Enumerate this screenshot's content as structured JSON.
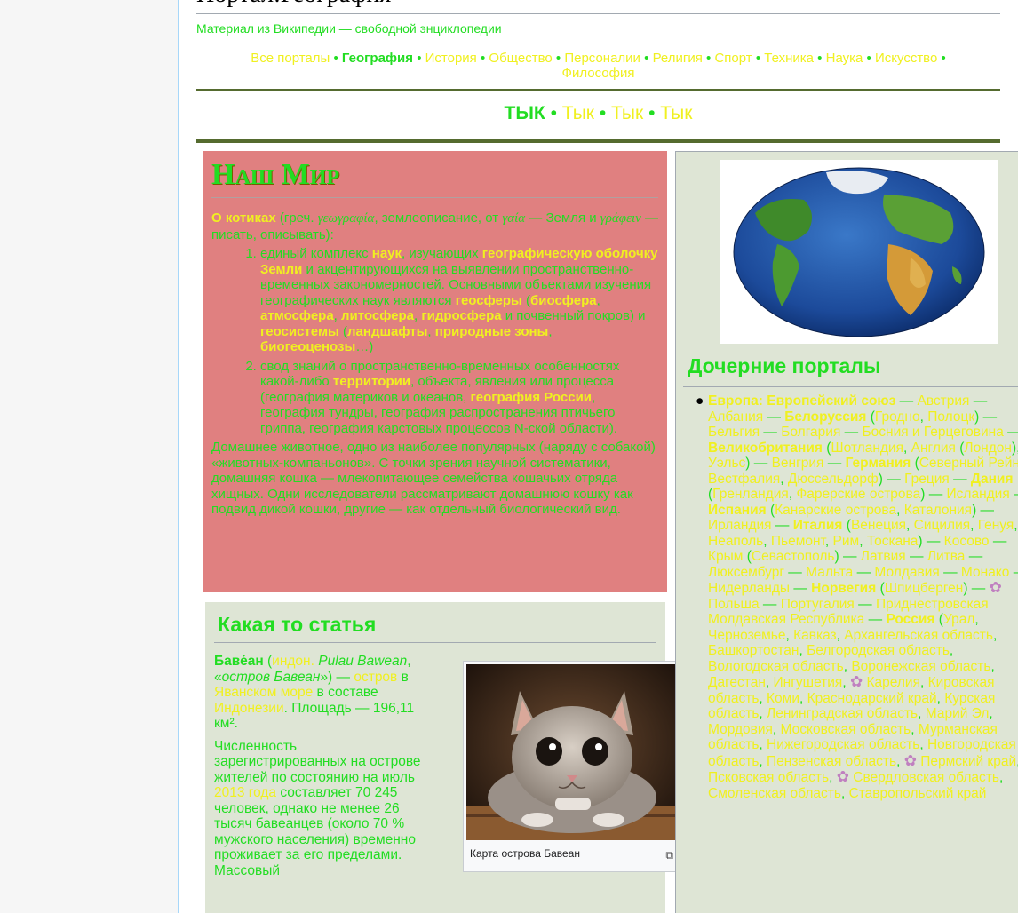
{
  "page": {
    "title": "Портал:География",
    "subtitle": "Материал из Википедии — свободной энциклопедии"
  },
  "portal_nav": {
    "items": [
      "Все порталы",
      "География",
      "История",
      "Общество",
      "Персоналии",
      "Религия",
      "Спорт",
      "Техника",
      "Наука",
      "Искусство",
      "Философия"
    ],
    "separator": "•"
  },
  "tyk_nav": {
    "items": [
      "ТЫК",
      "Тык",
      "Тык",
      "Тык"
    ],
    "separator": "•"
  },
  "world": {
    "title": "Наш Мир",
    "intro": {
      "bold": "О котиках",
      "text1": " (греч. ",
      "greek1": "γεωγραφία",
      "text2": ", землеописание, от ",
      "greek2": "γαία",
      "text3": " — Земля и ",
      "greek3": "γράφειν",
      "text4": " — писать, описывать):"
    },
    "item1": {
      "t1": "единый комплекс ",
      "l1": "наук",
      "t2": ", изучающих ",
      "l2": "географическую оболочку Земли",
      "t3": " и акцентирующихся на выявлении пространственно-временных закономерностей. Основными объектами изучения географических наук являются ",
      "l3": "геосферы",
      "t4": " (",
      "l4": "биосфера",
      "t5": ", ",
      "l5": "атмосфера",
      "t6": ", ",
      "l6": "литосфера",
      "t7": ", ",
      "l7": "гидросфера",
      "t8": " и почвенный покров) и ",
      "l8": "геосистемы",
      "t9": " (",
      "l9": "ландшафты",
      "t10": ", ",
      "l10": "природные зоны",
      "t11": ", ",
      "l11": "биогеоценозы",
      "t12": "…)"
    },
    "item2": {
      "t1": "свод знаний о пространственно-временных особенностях какой-либо ",
      "l1": "территории",
      "t2": ", объекта, явления или процесса (география материков и океанов, ",
      "l2": "география России",
      "t3": ", география тундры, география распространения птичьего гриппа, география карстовых процессов N-ской области)."
    },
    "para": "Домашнее животное, одно из наиболее популярных (наряду с собакой) «животных-компаньонов». С точки зрения научной систематики, домашняя кошка — млекопитающее семейства кошачьих отряда хищных. Одни исследователи рассматривают домашнюю кошку как подвид дикой кошки, другие — как отдельный биологический вид."
  },
  "article": {
    "title": "Какая то статья",
    "p1": {
      "name": "Баве́ан",
      "t1": " (",
      "l1": "индон.",
      "t2": " ",
      "i1": "Pulau Bawean",
      "t3": ", «",
      "i2": "остров Бавеан",
      "t4": "») — ",
      "l2": "остров",
      "t5": " в ",
      "l3": "Яванском море",
      "t6": " в составе ",
      "l4": "Индонезии",
      "t7": ". Площадь — 196,11 км²."
    },
    "p2": {
      "t1": "Численность зарегистрированных на острове жителей по состоянию на июль ",
      "l1": "2013 года",
      "t2": " составляет 70 245 человек, однако не менее 26 тысяч бавеанцев (около 70 % мужского населения) временно проживает за его пределами. Массовый"
    },
    "caption": "Карта острова Бавеан"
  },
  "subportals": {
    "title": "Дочерние порталы",
    "segments": [
      {
        "t": "Европа",
        "s": "by"
      },
      {
        "t": ": ",
        "s": "by"
      },
      {
        "t": "Европейский союз",
        "s": "by"
      },
      {
        "t": " — ",
        "s": "g"
      },
      {
        "t": "Австрия",
        "s": "y"
      },
      {
        "t": " — ",
        "s": "g"
      },
      {
        "t": "Албания",
        "s": "y"
      },
      {
        "t": " — ",
        "s": "g"
      },
      {
        "t": "Белоруссия",
        "s": "by"
      },
      {
        "t": " (",
        "s": "g"
      },
      {
        "t": "Гродно",
        "s": "y"
      },
      {
        "t": ", ",
        "s": "g"
      },
      {
        "t": "Полоцк",
        "s": "y"
      },
      {
        "t": ") — ",
        "s": "g"
      },
      {
        "t": "Бельгия",
        "s": "y"
      },
      {
        "t": " — ",
        "s": "g"
      },
      {
        "t": "Болгария",
        "s": "y"
      },
      {
        "t": " — ",
        "s": "g"
      },
      {
        "t": "Босния и Герцеговина",
        "s": "y"
      },
      {
        "t": " — ",
        "s": "g"
      },
      {
        "t": "Великобритания",
        "s": "by"
      },
      {
        "t": " (",
        "s": "g"
      },
      {
        "t": "Шотландия",
        "s": "y"
      },
      {
        "t": ", ",
        "s": "g"
      },
      {
        "t": "Англия",
        "s": "y"
      },
      {
        "t": " (",
        "s": "g"
      },
      {
        "t": "Лондон",
        "s": "y"
      },
      {
        "t": "), ",
        "s": "g"
      },
      {
        "t": "Уэльс",
        "s": "y"
      },
      {
        "t": ") — ",
        "s": "g"
      },
      {
        "t": "Венгрия",
        "s": "y"
      },
      {
        "t": " — ",
        "s": "g"
      },
      {
        "t": "Германия",
        "s": "by"
      },
      {
        "t": " (",
        "s": "g"
      },
      {
        "t": "Северный Рейн-Вестфалия",
        "s": "y"
      },
      {
        "t": ", ",
        "s": "g"
      },
      {
        "t": "Дюссельдорф",
        "s": "y"
      },
      {
        "t": ") — ",
        "s": "g"
      },
      {
        "t": "Греция",
        "s": "y"
      },
      {
        "t": " — ",
        "s": "g"
      },
      {
        "t": "Дания",
        "s": "by"
      },
      {
        "t": " (",
        "s": "g"
      },
      {
        "t": "Гренландия",
        "s": "y"
      },
      {
        "t": ", ",
        "s": "g"
      },
      {
        "t": "Фарерские острова",
        "s": "y"
      },
      {
        "t": ") — ",
        "s": "g"
      },
      {
        "t": "Исландия",
        "s": "y"
      },
      {
        "t": " — ",
        "s": "g"
      },
      {
        "t": "Испания",
        "s": "by"
      },
      {
        "t": " (",
        "s": "g"
      },
      {
        "t": "Канарские острова",
        "s": "y"
      },
      {
        "t": ", ",
        "s": "g"
      },
      {
        "t": "Каталония",
        "s": "y"
      },
      {
        "t": ") — ",
        "s": "g"
      },
      {
        "t": "Ирландия",
        "s": "y"
      },
      {
        "t": " — ",
        "s": "g"
      },
      {
        "t": "Италия",
        "s": "by"
      },
      {
        "t": " (",
        "s": "g"
      },
      {
        "t": "Венеция",
        "s": "y"
      },
      {
        "t": ", ",
        "s": "g"
      },
      {
        "t": "Сицилия",
        "s": "y"
      },
      {
        "t": ", ",
        "s": "g"
      },
      {
        "t": "Генуя",
        "s": "y"
      },
      {
        "t": ", ",
        "s": "g"
      },
      {
        "t": "Неаполь",
        "s": "y"
      },
      {
        "t": ", ",
        "s": "g"
      },
      {
        "t": "Пьемонт",
        "s": "y"
      },
      {
        "t": ", ",
        "s": "g"
      },
      {
        "t": "Рим",
        "s": "y"
      },
      {
        "t": ", ",
        "s": "g"
      },
      {
        "t": "Тоскана",
        "s": "y"
      },
      {
        "t": ") — ",
        "s": "g"
      },
      {
        "t": "Косово",
        "s": "y"
      },
      {
        "t": " — ",
        "s": "g"
      },
      {
        "t": "Крым",
        "s": "y"
      },
      {
        "t": " (",
        "s": "g"
      },
      {
        "t": "Севастополь",
        "s": "y"
      },
      {
        "t": ") — ",
        "s": "g"
      },
      {
        "t": "Латвия",
        "s": "y"
      },
      {
        "t": " — ",
        "s": "g"
      },
      {
        "t": "Литва",
        "s": "y"
      },
      {
        "t": " — ",
        "s": "g"
      },
      {
        "t": "Люксембург",
        "s": "y"
      },
      {
        "t": " — ",
        "s": "g"
      },
      {
        "t": "Мальта",
        "s": "y"
      },
      {
        "t": " — ",
        "s": "g"
      },
      {
        "t": "Молдавия",
        "s": "y"
      },
      {
        "t": " — ",
        "s": "g"
      },
      {
        "t": "Монако",
        "s": "y"
      },
      {
        "t": " — ",
        "s": "g"
      },
      {
        "t": "Нидерланды",
        "s": "y"
      },
      {
        "t": " — ",
        "s": "g"
      },
      {
        "t": "Норвегия",
        "s": "by"
      },
      {
        "t": " (",
        "s": "g"
      },
      {
        "t": "Шпицберген",
        "s": "y"
      },
      {
        "t": ") — ",
        "s": "g"
      },
      {
        "t": "flower",
        "s": "icon"
      },
      {
        "t": " Польша",
        "s": "y"
      },
      {
        "t": " — ",
        "s": "g"
      },
      {
        "t": "Португалия",
        "s": "y"
      },
      {
        "t": " — ",
        "s": "g"
      },
      {
        "t": "Приднестровская Молдавская Республика",
        "s": "y"
      },
      {
        "t": " — ",
        "s": "g"
      },
      {
        "t": "Россия",
        "s": "by"
      },
      {
        "t": " (",
        "s": "g"
      },
      {
        "t": "Урал",
        "s": "y"
      },
      {
        "t": ", ",
        "s": "g"
      },
      {
        "t": "Черноземье",
        "s": "y"
      },
      {
        "t": ", ",
        "s": "g"
      },
      {
        "t": "Кавказ",
        "s": "y"
      },
      {
        "t": ", ",
        "s": "g"
      },
      {
        "t": "Архангельская область",
        "s": "y"
      },
      {
        "t": ", ",
        "s": "g"
      },
      {
        "t": "Башкортостан",
        "s": "y"
      },
      {
        "t": ", ",
        "s": "g"
      },
      {
        "t": "Белгородская область",
        "s": "y"
      },
      {
        "t": ", ",
        "s": "g"
      },
      {
        "t": "Вологодская область",
        "s": "y"
      },
      {
        "t": ", ",
        "s": "g"
      },
      {
        "t": "Воронежская область",
        "s": "y"
      },
      {
        "t": ", ",
        "s": "g"
      },
      {
        "t": "Дагестан",
        "s": "y"
      },
      {
        "t": ", ",
        "s": "g"
      },
      {
        "t": "Ингушетия",
        "s": "y"
      },
      {
        "t": ", ",
        "s": "g"
      },
      {
        "t": "flower",
        "s": "icon"
      },
      {
        "t": " Карелия",
        "s": "y"
      },
      {
        "t": ", ",
        "s": "g"
      },
      {
        "t": "Кировская область",
        "s": "y"
      },
      {
        "t": ", ",
        "s": "g"
      },
      {
        "t": "Коми",
        "s": "y"
      },
      {
        "t": ", ",
        "s": "g"
      },
      {
        "t": "Краснодарский край",
        "s": "y"
      },
      {
        "t": ", ",
        "s": "g"
      },
      {
        "t": "Курская область",
        "s": "y"
      },
      {
        "t": ", ",
        "s": "g"
      },
      {
        "t": "Ленинградская область",
        "s": "y"
      },
      {
        "t": ", ",
        "s": "g"
      },
      {
        "t": "Марий Эл",
        "s": "y"
      },
      {
        "t": ", ",
        "s": "g"
      },
      {
        "t": "Мордовия",
        "s": "y"
      },
      {
        "t": ", ",
        "s": "g"
      },
      {
        "t": "Московская область",
        "s": "y"
      },
      {
        "t": ", ",
        "s": "g"
      },
      {
        "t": "Мурманская область",
        "s": "y"
      },
      {
        "t": ", ",
        "s": "g"
      },
      {
        "t": "Нижегородская область",
        "s": "y"
      },
      {
        "t": ", ",
        "s": "g"
      },
      {
        "t": "Новгородская область",
        "s": "y"
      },
      {
        "t": ", ",
        "s": "g"
      },
      {
        "t": "Пензенская область",
        "s": "y"
      },
      {
        "t": ", ",
        "s": "g"
      },
      {
        "t": "flower",
        "s": "icon"
      },
      {
        "t": " Пермский край",
        "s": "y"
      },
      {
        "t": ", ",
        "s": "g"
      },
      {
        "t": "Псковская область",
        "s": "y"
      },
      {
        "t": ", ",
        "s": "g"
      },
      {
        "t": "flower",
        "s": "icon"
      },
      {
        "t": " Свердловская область",
        "s": "y"
      },
      {
        "t": ", ",
        "s": "g"
      },
      {
        "t": "Смоленская область",
        "s": "y"
      },
      {
        "t": ", ",
        "s": "g"
      },
      {
        "t": "Ставропольский край",
        "s": "y"
      }
    ]
  },
  "colors": {
    "text_green": "#22dd22",
    "link_yellow": "#f0f020",
    "world_bg": "#e08080",
    "panel_bg": "#dee5d5",
    "rule_olive": "#556b2f"
  },
  "icons": {
    "flower": "flower-icon",
    "enlarge": "enlarge-icon"
  }
}
